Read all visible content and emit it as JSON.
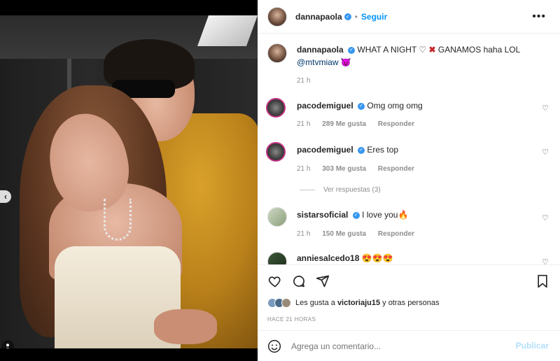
{
  "post": {
    "username": "dannapaola",
    "follow_label": "Seguir",
    "separator": "•",
    "more_label": "•••",
    "caption_text_part1": " WHAT A NIGHT ",
    "caption_text_part2": " GANAMOS haha LOL",
    "caption_mention": "@mtvmiaw",
    "caption_time": "21 h"
  },
  "comments": [
    {
      "username": "pacodemiguel",
      "text": "Omg omg omg",
      "time": "21 h",
      "likes": "289 Me gusta",
      "reply": "Responder"
    },
    {
      "username": "pacodemiguel",
      "text": "Eres top",
      "time": "21 h",
      "likes": "303 Me gusta",
      "reply": "Responder",
      "view_replies": "Ver respuestas (3)"
    },
    {
      "username": "sistarsoficial",
      "text": "I love you",
      "time": "21 h",
      "likes": "150 Me gusta",
      "reply": "Responder"
    },
    {
      "username": "anniesalcedo18",
      "text": ""
    }
  ],
  "likes_line": {
    "prefix": "Les gusta a ",
    "user": "victoriaju15",
    "suffix": " y otras personas"
  },
  "time_ago": "HACE 21 HORAS",
  "add_comment": {
    "placeholder": "Agrega un comentario...",
    "publish_label": "Publicar"
  },
  "colors": {
    "verified": "#3897f0",
    "follow": "#0095f6",
    "publish_disabled": "#b2dffc",
    "carousel_active": "#1e88e5"
  },
  "carousel": {
    "dots_total": 5,
    "active_index": 4
  },
  "icons": [
    "chevron-left-icon",
    "tag-user-icon",
    "heart-icon",
    "comment-icon",
    "share-icon",
    "bookmark-icon",
    "emoji-icon"
  ]
}
